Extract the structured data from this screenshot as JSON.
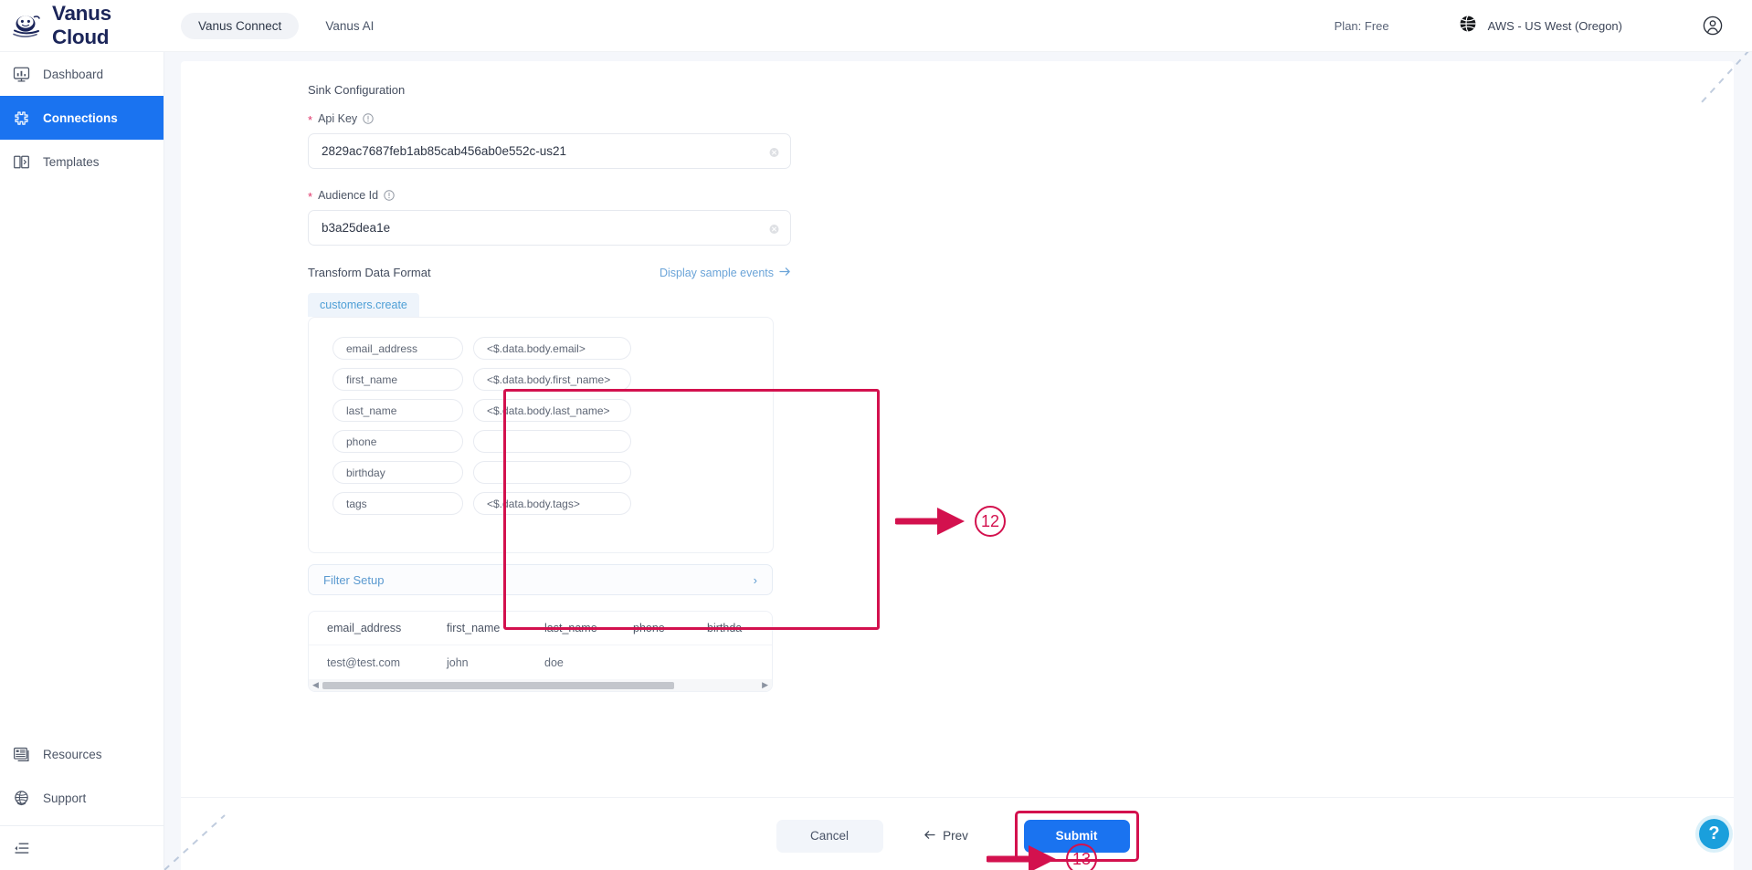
{
  "header": {
    "brand_name": "Vanus Cloud",
    "brand_logo_icon": "vanus-whale-logo",
    "tabs": [
      {
        "label": "Vanus Connect",
        "active": true
      },
      {
        "label": "Vanus AI",
        "active": false
      }
    ],
    "plan": "Plan: Free",
    "region_icon": "globe-icon",
    "region": "AWS - US West (Oregon)",
    "account_icon": "user-circle-icon"
  },
  "sidebar": {
    "items": [
      {
        "label": "Dashboard",
        "icon": "dashboard-icon",
        "active": false
      },
      {
        "label": "Connections",
        "icon": "connections-icon",
        "active": true
      },
      {
        "label": "Templates",
        "icon": "templates-icon",
        "active": false
      }
    ],
    "bottom_items": [
      {
        "label": "Resources",
        "icon": "resources-icon"
      },
      {
        "label": "Support",
        "icon": "support-globe-icon"
      }
    ],
    "collapse_icon": "collapse-sidebar-icon"
  },
  "form": {
    "sink_section_title": "Sink Configuration",
    "api_key": {
      "label": "Api Key",
      "required_marker": "*",
      "info_icon": "info-circle-icon",
      "value": "2829ac7687feb1ab85cab456ab0e552c-us21",
      "clear_icon": "clear-circle-icon"
    },
    "audience_id": {
      "label": "Audience Id",
      "required_marker": "*",
      "info_icon": "info-circle-icon",
      "value": "b3a25dea1e",
      "clear_icon": "clear-circle-icon"
    },
    "transform": {
      "title": "Transform Data Format",
      "sample_link": "Display sample events",
      "sample_link_icon": "arrow-right-icon",
      "tab_label": "customers.create",
      "mappings": [
        {
          "key": "email_address",
          "value": "<$.data.body.email>"
        },
        {
          "key": "first_name",
          "value": "<$.data.body.first_name>"
        },
        {
          "key": "last_name",
          "value": "<$.data.body.last_name>"
        },
        {
          "key": "phone",
          "value": ""
        },
        {
          "key": "birthday",
          "value": ""
        },
        {
          "key": "tags",
          "value": "<$.data.body.tags>"
        }
      ]
    },
    "filter_setup": {
      "label": "Filter Setup",
      "expand_icon": "chevron-right-icon"
    },
    "preview_table": {
      "columns": [
        "email_address",
        "first_name",
        "last_name",
        "phone",
        "birthda"
      ],
      "rows": [
        [
          "test@test.com",
          "john",
          "doe",
          "",
          ""
        ]
      ],
      "scroll_left_icon": "scroll-left-arrow",
      "scroll_right_icon": "scroll-right-arrow"
    }
  },
  "footer": {
    "cancel_label": "Cancel",
    "prev_label": "Prev",
    "prev_icon": "arrow-left-icon",
    "submit_label": "Submit"
  },
  "annotations": {
    "marker_12": "12",
    "marker_13": "13",
    "arrow_icon": "annotation-arrow-right",
    "highlight_color": "#d3114e"
  },
  "help": {
    "label": "?",
    "icon": "help-question-icon"
  },
  "colors": {
    "accent_blue": "#1a73f0",
    "annotation_red": "#d3114e",
    "page_bg": "#f5f7fb",
    "link_blue": "#5b9ad0",
    "help_blue": "#1a9fdc"
  }
}
